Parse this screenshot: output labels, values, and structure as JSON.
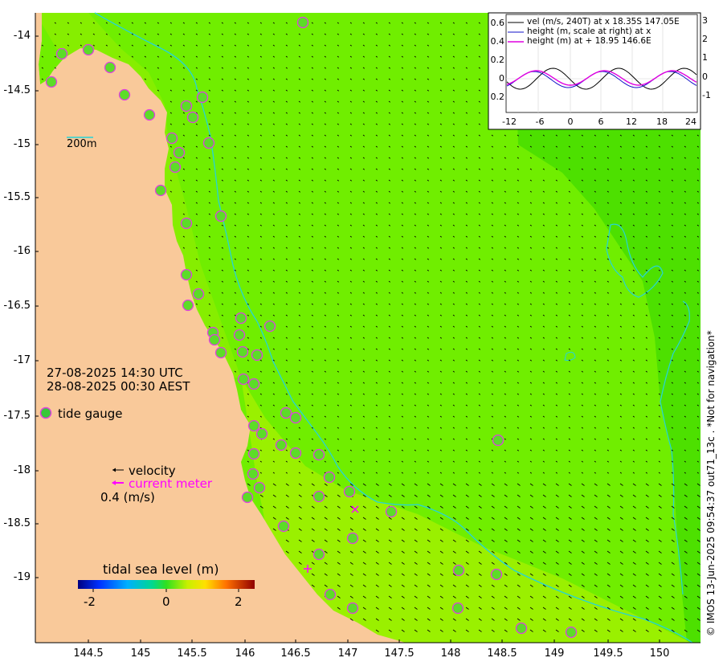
{
  "map": {
    "y_ticks": [
      "-14",
      "-14.5",
      "-15",
      "-15.5",
      "-16",
      "-16.5",
      "-17",
      "-17.5",
      "-18",
      "-18.5",
      "-19"
    ],
    "x_ticks": [
      "144.5",
      "145",
      "145.5",
      "146",
      "146.5",
      "147",
      "147.5",
      "148",
      "148.5",
      "149",
      "149.5",
      "150"
    ],
    "scale_bar_label": "200m",
    "timestamp_utc": "27-08-2025 14:30 UTC",
    "timestamp_aest": "28-08-2025 00:30 AEST",
    "colors": {
      "land": "#f9c99a",
      "sea_base": "#70ee00",
      "sea_coastal": "#9af000",
      "sea_deep": "#4de000",
      "contour": "#26d4d8",
      "gauge_ring": "#e040e0",
      "current_meter": "#ff00ff"
    }
  },
  "legend": {
    "tide_gauge": "tide gauge",
    "velocity": "velocity",
    "current_meter": "current meter",
    "scale": "0.4 (m/s)",
    "colorbar_title": "tidal sea level (m)",
    "colorbar_ticks": [
      "-2",
      "0",
      "2"
    ]
  },
  "inset": {
    "line1": "vel (m/s, 240T) at x 18.35S 147.05E",
    "line2": "height (m, scale at right) at x",
    "line3": "height (m) at + 18.95 146.6E",
    "left_ticks": [
      "0.6",
      "0.4",
      "0.2",
      "0",
      "0.2"
    ],
    "right_ticks": [
      "3",
      "2",
      "1",
      "0",
      "-1"
    ],
    "x_ticks": [
      "-12",
      "-6",
      "0",
      "6",
      "12",
      "18",
      "24"
    ]
  },
  "stamp": "© IMOS 13-Jun-2025 09:54:37 out71_13c . *Not for navigation*"
}
